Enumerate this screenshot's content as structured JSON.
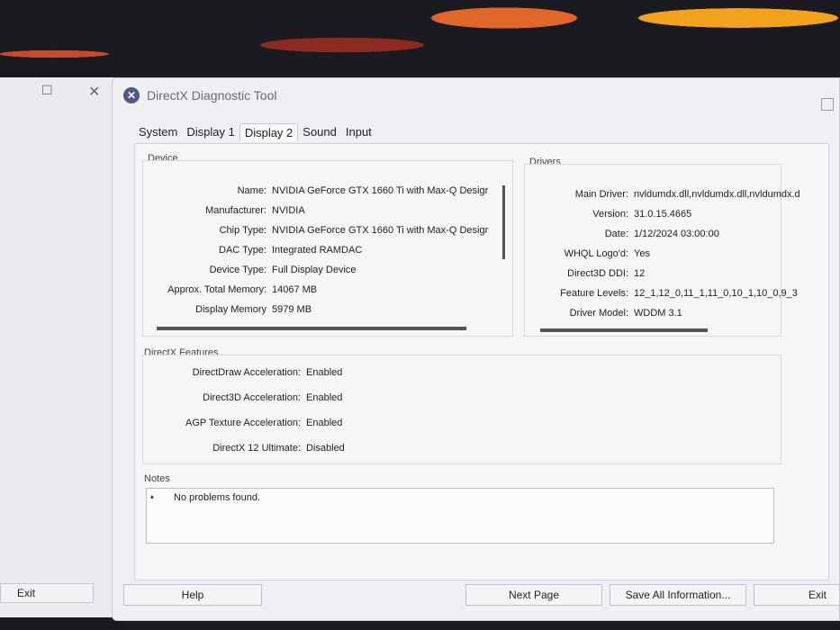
{
  "back_window": {
    "restore_symbol": "☐",
    "close_symbol": "✕",
    "exit_label": "Exit"
  },
  "dialog": {
    "title": "DirectX Diagnostic Tool",
    "icon": "directx-x-icon",
    "tabs": [
      "System",
      "Display 1",
      "Display 2",
      "Sound",
      "Input"
    ],
    "active_tab": "Display 2"
  },
  "device": {
    "label": "Device",
    "rows": [
      {
        "key": "Name:",
        "value": "NVIDIA GeForce GTX 1660 Ti with Max-Q Desigr"
      },
      {
        "key": "Manufacturer:",
        "value": "NVIDIA"
      },
      {
        "key": "Chip Type:",
        "value": "NVIDIA GeForce GTX 1660 Ti with Max-Q Desigr"
      },
      {
        "key": "DAC Type:",
        "value": "Integrated RAMDAC"
      },
      {
        "key": "Device Type:",
        "value": "Full Display Device"
      },
      {
        "key": "Approx. Total Memory:",
        "value": "14067 MB"
      },
      {
        "key": "Display Memory",
        "value": "5979 MB"
      }
    ]
  },
  "drivers": {
    "label": "Drivers",
    "rows": [
      {
        "key": "Main Driver:",
        "value": "nvldumdx.dll,nvldumdx.dll,nvldumdx.d"
      },
      {
        "key": "Version:",
        "value": "31.0.15.4665"
      },
      {
        "key": "Date:",
        "value": "1/12/2024 03:00:00"
      },
      {
        "key": "WHQL Logo'd:",
        "value": "Yes"
      },
      {
        "key": "Direct3D DDI:",
        "value": "12"
      },
      {
        "key": "Feature Levels:",
        "value": "12_1,12_0,11_1,11_0,10_1,10_0,9_3"
      },
      {
        "key": "Driver Model:",
        "value": "WDDM 3.1"
      }
    ]
  },
  "features": {
    "label": "DirectX Features",
    "rows": [
      {
        "key": "DirectDraw Acceleration:",
        "value": "Enabled"
      },
      {
        "key": "Direct3D Acceleration:",
        "value": "Enabled"
      },
      {
        "key": "AGP Texture Acceleration:",
        "value": "Enabled"
      },
      {
        "key": "DirectX 12 Ultimate:",
        "value": "Disabled"
      }
    ]
  },
  "notes": {
    "label": "Notes",
    "bullet": "•",
    "items": [
      "No problems found."
    ]
  },
  "buttons": {
    "help": "Help",
    "next_page": "Next Page",
    "save_all": "Save All Information...",
    "exit": "Exit"
  }
}
